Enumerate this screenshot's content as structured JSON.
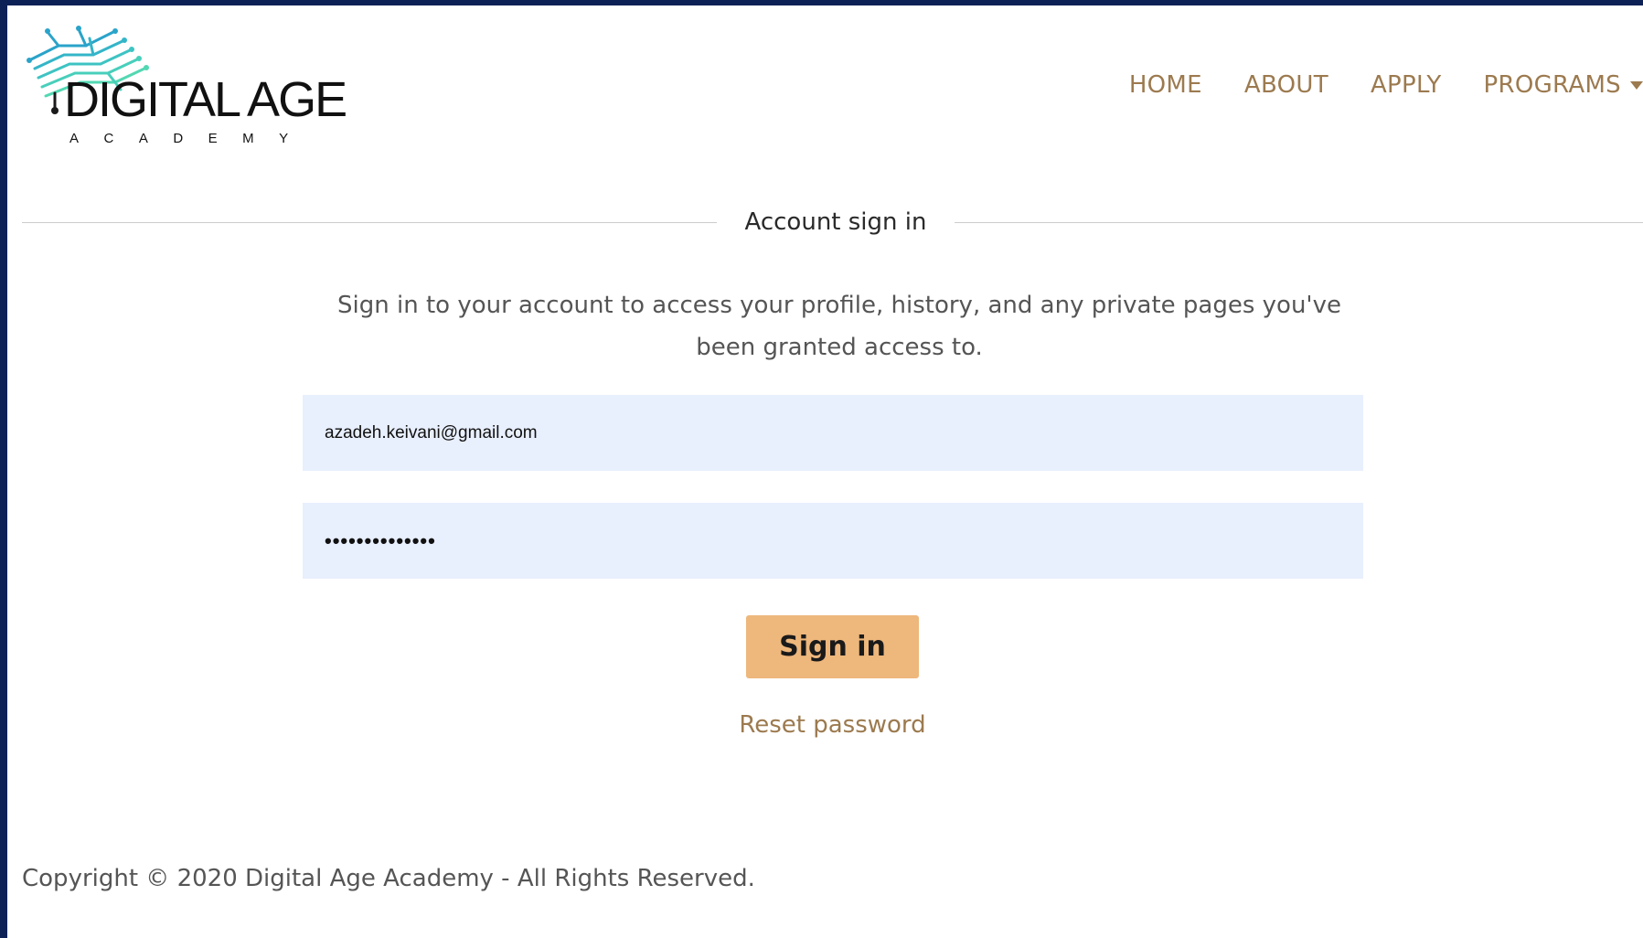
{
  "brand": {
    "logo_main": "DIGITAL AGE",
    "logo_sub": "ACADEMY"
  },
  "nav": {
    "items": [
      "HOME",
      "ABOUT",
      "APPLY",
      "PROGRAMS"
    ]
  },
  "signin": {
    "heading": "Account sign in",
    "description": "Sign in to your account to access your profile, history, and any private pages you've been granted access to.",
    "email_value": "azadeh.keivani@gmail.com",
    "password_value": "••••••••••••••",
    "button_label": "Sign in",
    "reset_label": "Reset password"
  },
  "footer": {
    "copyright": "Copyright © 2020 Digital Age Academy - All Rights Reserved."
  },
  "colors": {
    "frame": "#0c2257",
    "accent": "#9c7a4f",
    "button": "#eeb77c",
    "input_bg": "#e8effd"
  }
}
